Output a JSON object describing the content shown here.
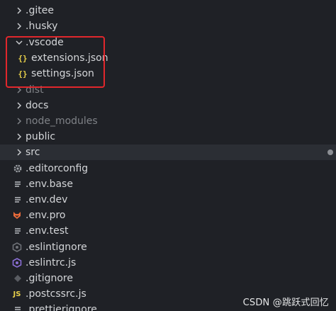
{
  "explorer": {
    "items": [
      {
        "label": ".gitee",
        "icon": "chevron-right-icon",
        "dim": false
      },
      {
        "label": ".husky",
        "icon": "chevron-right-icon",
        "dim": false
      },
      {
        "label": ".vscode",
        "icon": "chevron-down-icon",
        "dim": false
      },
      {
        "label": "extensions.json",
        "icon": "json-braces-icon",
        "dim": false
      },
      {
        "label": "settings.json",
        "icon": "json-braces-icon",
        "dim": false
      },
      {
        "label": "dist",
        "icon": "chevron-right-icon",
        "dim": true
      },
      {
        "label": "docs",
        "icon": "chevron-right-icon",
        "dim": false
      },
      {
        "label": "node_modules",
        "icon": "chevron-right-icon",
        "dim": true
      },
      {
        "label": "public",
        "icon": "chevron-right-icon",
        "dim": false
      },
      {
        "label": "src",
        "icon": "chevron-right-icon",
        "dim": false,
        "selected": true
      },
      {
        "label": ".editorconfig",
        "icon": "gear-icon",
        "dim": false
      },
      {
        "label": ".env.base",
        "icon": "lines-icon",
        "dim": false
      },
      {
        "label": ".env.dev",
        "icon": "lines-icon",
        "dim": false
      },
      {
        "label": ".env.pro",
        "icon": "fox-icon",
        "dim": false
      },
      {
        "label": ".env.test",
        "icon": "lines-icon",
        "dim": false
      },
      {
        "label": ".eslintignore",
        "icon": "eslint-icon",
        "dim": false
      },
      {
        "label": ".eslintrc.js",
        "icon": "eslint-icon",
        "dim": false
      },
      {
        "label": ".gitignore",
        "icon": "git-diamond-icon",
        "dim": false
      },
      {
        "label": ".postcssrc.js",
        "icon": "js-icon",
        "dim": false
      },
      {
        "label": ".prettierignore",
        "icon": "lines-icon",
        "dim": false
      }
    ]
  },
  "watermark": "CSDN @跳跃式回忆",
  "colors": {
    "background": "#1f2126",
    "selected_row": "#2b2e34",
    "json_icon": "#e8d04a",
    "annotation_border": "#e1272c",
    "fox_icon": "#e86a3a",
    "eslint_icon": "#8b6fd6",
    "js_icon": "#e8d04a"
  }
}
